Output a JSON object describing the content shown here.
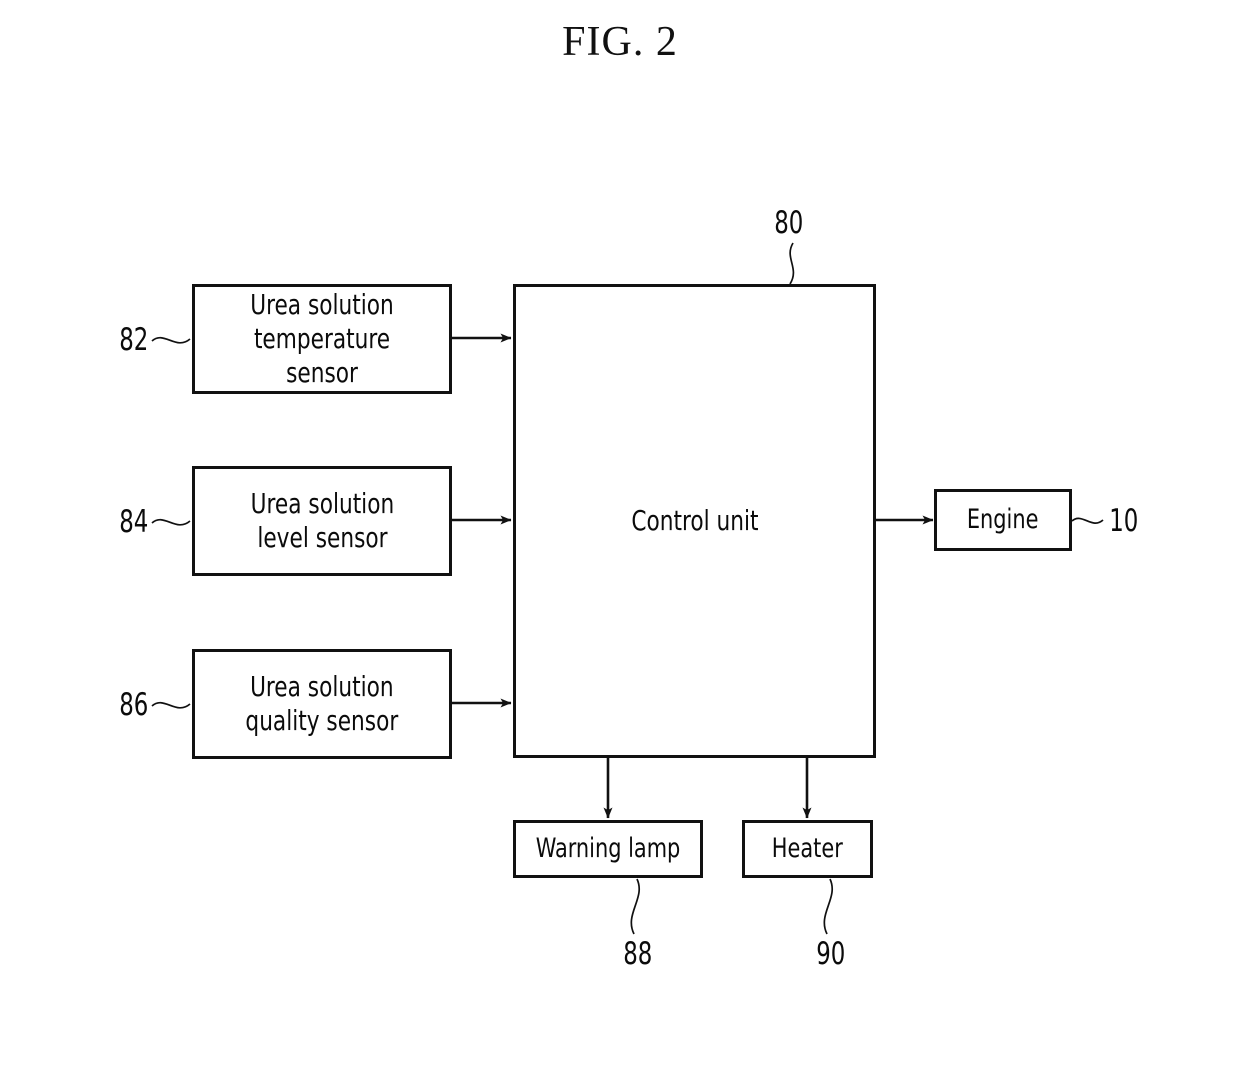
{
  "figure": {
    "title": "FIG. 2",
    "domain_kind": "patent-block-diagram"
  },
  "blocks": {
    "temperature_sensor": {
      "label": "Urea solution\ntemperature sensor",
      "ref": "82"
    },
    "level_sensor": {
      "label": "Urea solution\nlevel sensor",
      "ref": "84"
    },
    "quality_sensor": {
      "label": "Urea solution\nquality sensor",
      "ref": "86"
    },
    "control_unit": {
      "label": "Control unit",
      "ref": "80"
    },
    "engine": {
      "label": "Engine",
      "ref": "10"
    },
    "warning_lamp": {
      "label": "Warning lamp",
      "ref": "88"
    },
    "heater": {
      "label": "Heater",
      "ref": "90"
    }
  },
  "connections": [
    {
      "from": "temperature_sensor",
      "to": "control_unit",
      "direction": "right"
    },
    {
      "from": "level_sensor",
      "to": "control_unit",
      "direction": "right"
    },
    {
      "from": "quality_sensor",
      "to": "control_unit",
      "direction": "right"
    },
    {
      "from": "control_unit",
      "to": "engine",
      "direction": "right"
    },
    {
      "from": "control_unit",
      "to": "warning_lamp",
      "direction": "down"
    },
    {
      "from": "control_unit",
      "to": "heater",
      "direction": "down"
    }
  ],
  "colors": {
    "ink": "#111111",
    "paper": "#ffffff"
  }
}
